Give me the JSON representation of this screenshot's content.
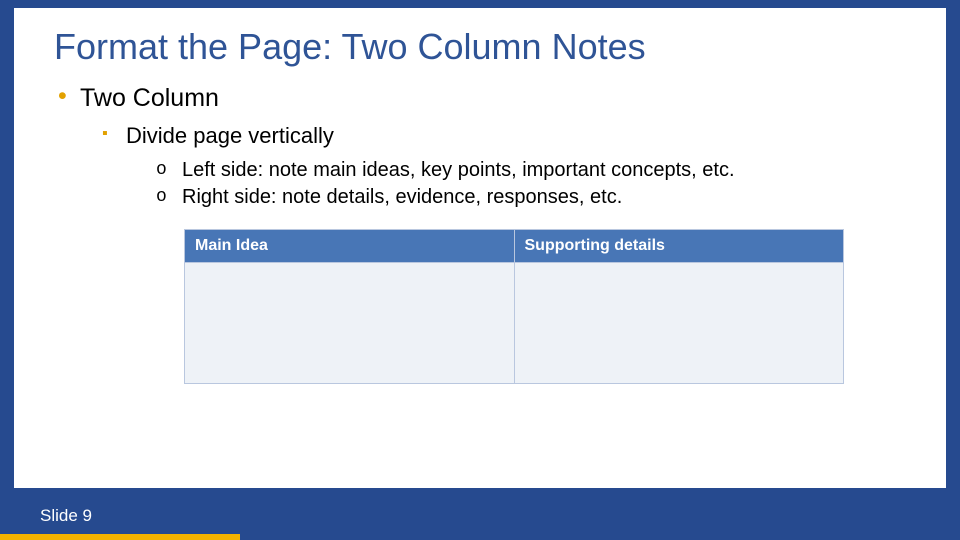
{
  "title": "Format the Page: Two Column Notes",
  "bullets": {
    "lvl1": "Two Column",
    "lvl2": "Divide page vertically",
    "lvl3a": "Left side: note main ideas, key points, important concepts, etc.",
    "lvl3b": "Right side: note details, evidence, responses, etc."
  },
  "table": {
    "header_left": "Main Idea",
    "header_right": "Supporting details"
  },
  "footer": "Slide 9"
}
